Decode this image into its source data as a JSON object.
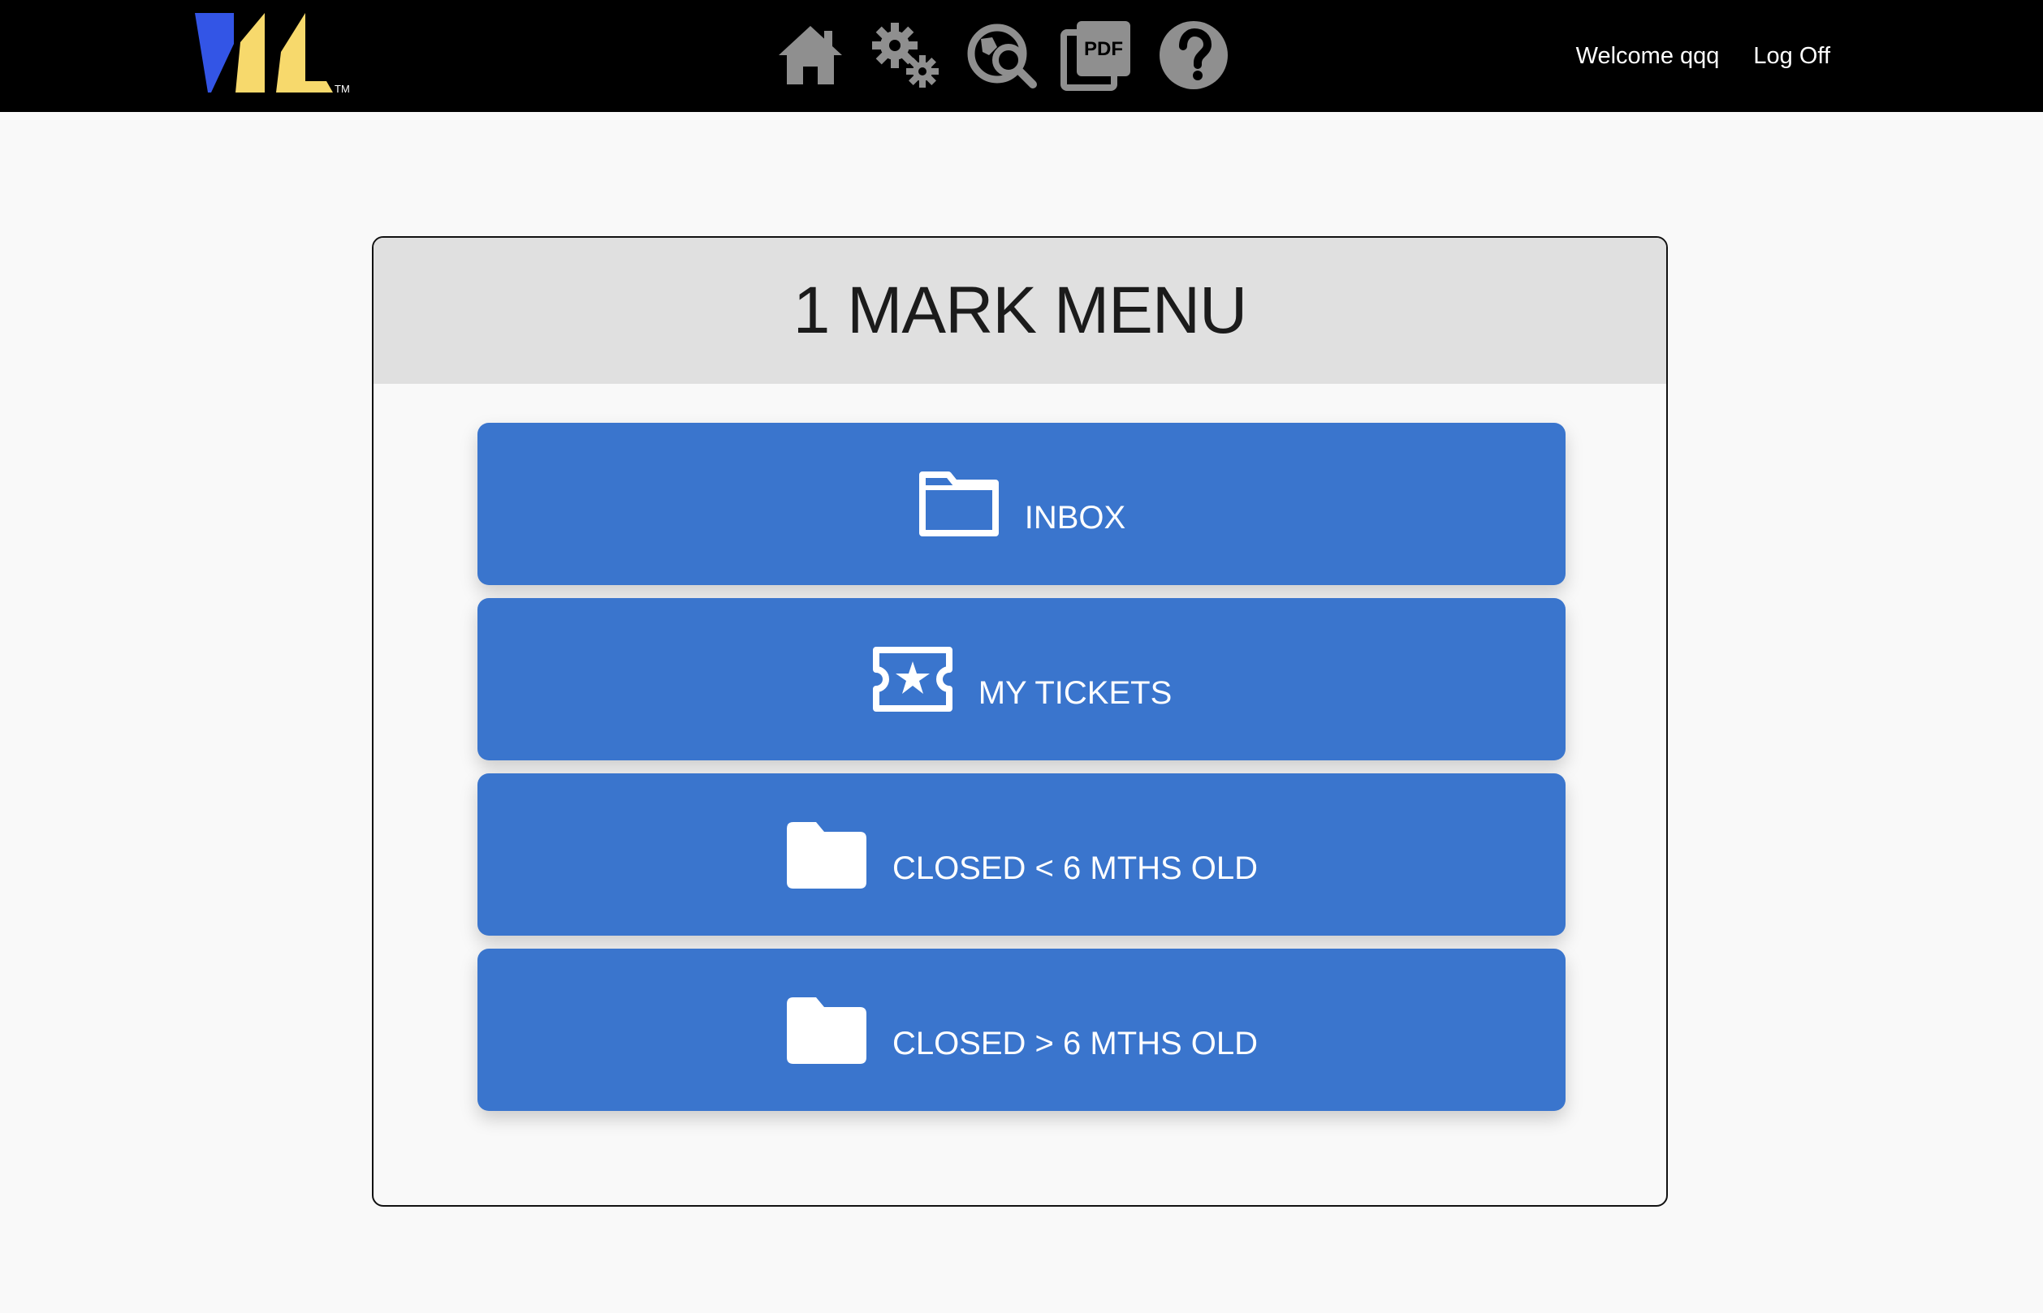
{
  "header": {
    "logo_icon": "brand-logo-icon",
    "nav_icons": [
      {
        "name": "home-icon"
      },
      {
        "name": "settings-gears-icon"
      },
      {
        "name": "search-globe-icon"
      },
      {
        "name": "pdf-icon",
        "text": "PDF"
      },
      {
        "name": "help-icon"
      }
    ],
    "welcome": "Welcome qqq",
    "logoff": "Log Off"
  },
  "main": {
    "title": "1 MARK MENU",
    "menu": [
      {
        "label": "INBOX",
        "icon": "folder-outline-icon"
      },
      {
        "label": "MY TICKETS",
        "icon": "ticket-star-icon"
      },
      {
        "label": "CLOSED < 6 MTHS OLD",
        "icon": "folder-filled-icon"
      },
      {
        "label": "CLOSED > 6 MTHS OLD",
        "icon": "folder-filled-icon"
      }
    ]
  },
  "colors": {
    "topbar": "#000000",
    "button": "#3a75cd",
    "header_band": "#e0e0e0",
    "icon_gray": "#8f8f8f",
    "logo_blue": "#3355e6",
    "logo_yellow": "#f7d96c"
  }
}
